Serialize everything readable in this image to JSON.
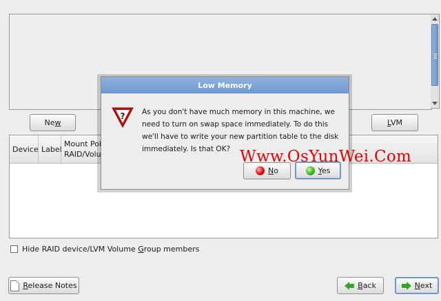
{
  "buttons": {
    "new": {
      "pre": "Ne",
      "key": "w",
      "post": ""
    },
    "lvm": {
      "pre": "",
      "key": "L",
      "post": "VM"
    }
  },
  "table": {
    "columns": [
      {
        "l1": "Device",
        "l2": ""
      },
      {
        "l1": "Label",
        "l2": ""
      },
      {
        "l1": "Mount Poi",
        "l2": "RAID/Volu"
      }
    ]
  },
  "hide_members": {
    "pre": "Hide RAID device/LVM Volume ",
    "key": "G",
    "post": "roup members"
  },
  "dialog": {
    "title": "Low Memory",
    "message": "As you don't have much memory in this machine, we need to turn on swap space immediately. To do this we'll have to write your new partition table to the disk immediately. Is that OK?",
    "no": {
      "key": "N",
      "post": "o"
    },
    "yes": {
      "key": "Y",
      "post": "es"
    }
  },
  "watermark": "Www.OsYunWei.Com",
  "footer": {
    "release_notes": {
      "pre": "",
      "key": "R",
      "post": "elease Notes"
    },
    "back": {
      "key": "B",
      "post": "ack"
    },
    "next": {
      "key": "N",
      "post": "ext"
    }
  },
  "colors": {
    "title_bar": "#7ba3d4",
    "watermark": "#e30000",
    "accent_green": "#37a42a"
  }
}
